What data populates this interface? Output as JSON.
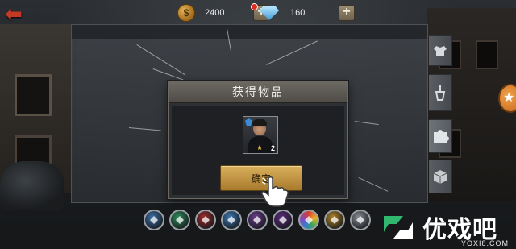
{
  "topbar": {
    "back_icon": "back-arrow-icon",
    "gold": {
      "icon": "coin-icon",
      "symbol": "$",
      "value": "2400"
    },
    "gems": {
      "icon": "gem-icon",
      "value": "160"
    },
    "plus_label": "+"
  },
  "dialog": {
    "title": "获得物品",
    "reward": {
      "icon": "character-card-icon",
      "stars": "★",
      "count": "2"
    },
    "confirm_label": "确定"
  },
  "side_tabs": [
    "armor-icon",
    "pin-icon",
    "puzzle-icon",
    "crate-icon"
  ],
  "bottom_emblems": [
    {
      "icon": "emblem-blue",
      "color": "#3d6fa6"
    },
    {
      "icon": "emblem-green",
      "color": "#2f8a5a"
    },
    {
      "icon": "emblem-red",
      "color": "#9c2c2c"
    },
    {
      "icon": "emblem-blue-star",
      "color": "#3c78b2"
    },
    {
      "icon": "emblem-purple-wing",
      "color": "#6a3d8c"
    },
    {
      "icon": "emblem-violet",
      "color": "#5a2c7a"
    },
    {
      "icon": "emblem-multicolor",
      "color": "#c8412f"
    },
    {
      "icon": "emblem-gold",
      "color": "#b08428"
    },
    {
      "icon": "emblem-silver",
      "color": "#8a8f96"
    }
  ],
  "watermark": {
    "main": "优戏吧",
    "sub": "YOXI8.COM"
  },
  "colors": {
    "accent_gold": "#d9b05c",
    "back_red": "#c23a25",
    "green_logo": "#3fc27a"
  }
}
